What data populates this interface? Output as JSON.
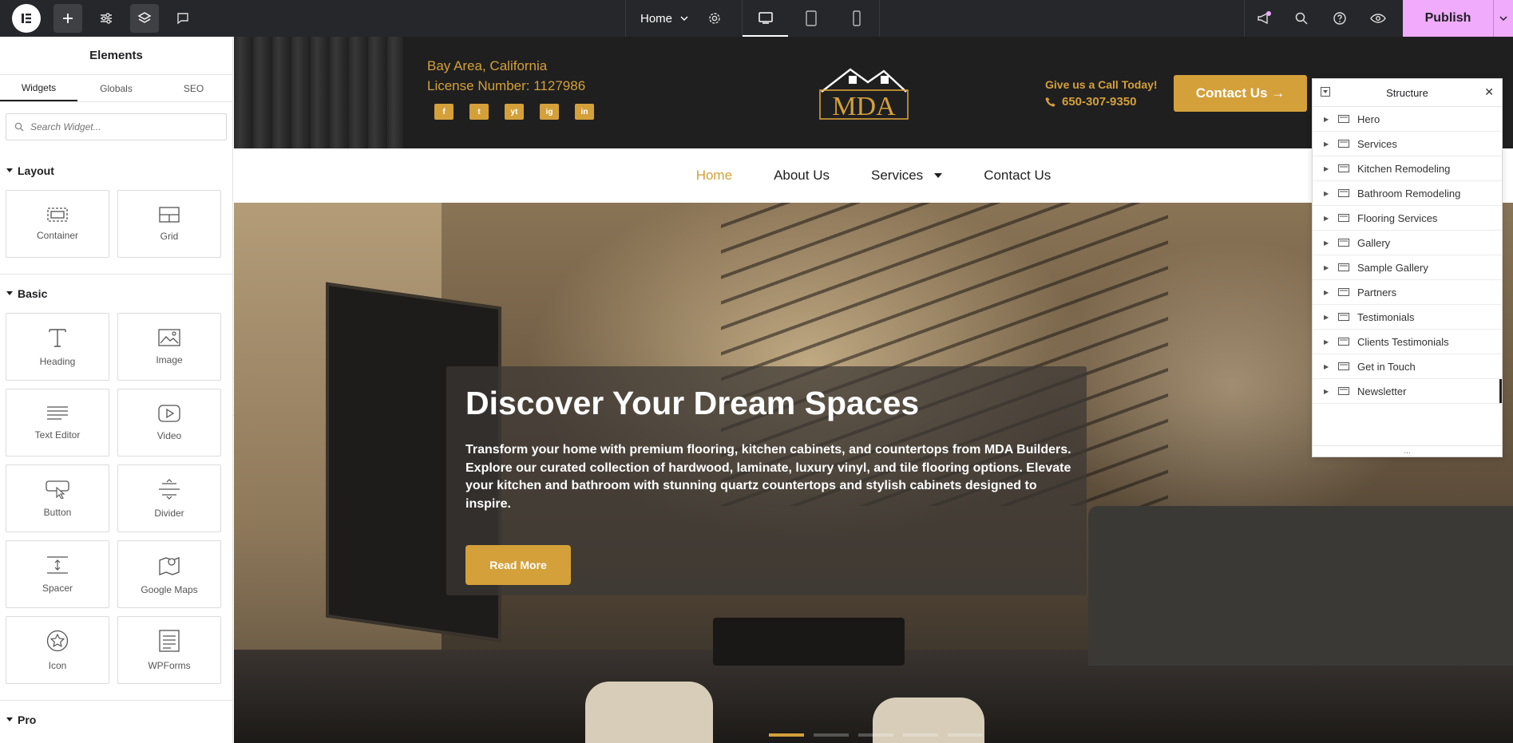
{
  "topbar": {
    "page_name": "Home",
    "publish_label": "Publish"
  },
  "panel": {
    "title": "Elements",
    "tabs": [
      "Widgets",
      "Globals",
      "SEO"
    ],
    "search_placeholder": "Search Widget...",
    "sections": {
      "layout": {
        "label": "Layout",
        "widgets": [
          "Container",
          "Grid"
        ]
      },
      "basic": {
        "label": "Basic",
        "widgets": [
          "Heading",
          "Image",
          "Text Editor",
          "Video",
          "Button",
          "Divider",
          "Spacer",
          "Google Maps",
          "Icon",
          "WPForms"
        ]
      },
      "pro": {
        "label": "Pro"
      }
    }
  },
  "site": {
    "address": "Bay Area, California",
    "license": "License Number: 1127986",
    "social": [
      "f",
      "t",
      "yt",
      "ig",
      "in"
    ],
    "logo_text": "MDA",
    "call_label": "Give us a Call Today!",
    "phone": "650-307-9350",
    "contact_button": "Contact Us →",
    "nav": [
      "Home",
      "About Us",
      "Services",
      "Contact Us"
    ],
    "hero_title": "Discover Your Dream Spaces",
    "hero_text": "Transform your home with premium flooring, kitchen cabinets, and countertops from MDA Builders. Explore our curated collection of hardwood, laminate, luxury vinyl, and tile flooring options. Elevate your kitchen and bathroom with stunning quartz countertops and stylish cabinets designed to inspire.",
    "hero_button": "Read More"
  },
  "structure": {
    "title": "Structure",
    "items": [
      "Hero",
      "Services",
      "Kitchen Remodeling",
      "Bathroom Remodeling",
      "Flooring Services",
      "Gallery",
      "Sample Gallery",
      "Partners",
      "Testimonials",
      "Clients Testimonials",
      "Get in Touch",
      "Newsletter"
    ],
    "footer": "..."
  },
  "colors": {
    "accent_gold": "#d4a03a",
    "publish_pink": "#f0abfc",
    "topbar_bg": "#26272b"
  }
}
